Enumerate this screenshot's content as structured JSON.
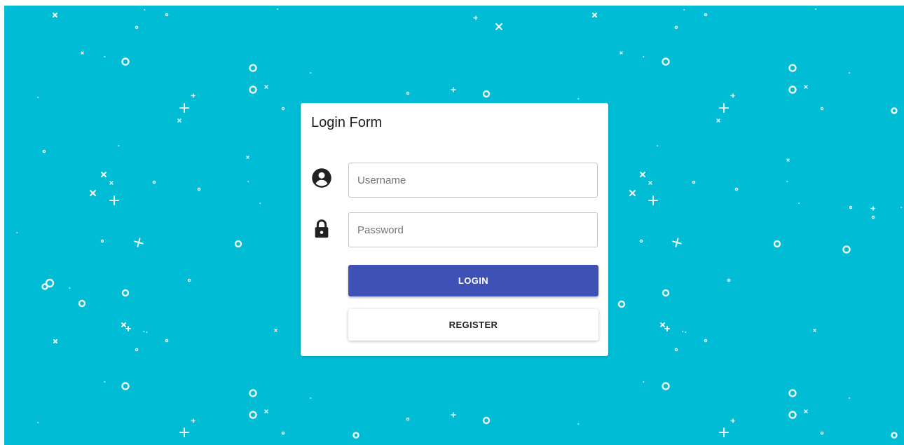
{
  "form": {
    "title": "Login Form",
    "username": {
      "placeholder": "Username",
      "value": "",
      "icon": "account-circle-icon"
    },
    "password": {
      "placeholder": "Password",
      "value": "",
      "icon": "lock-icon"
    },
    "login_label": "LOGIN",
    "register_label": "REGISTER"
  },
  "colors": {
    "background": "#00bcd4",
    "card": "#ffffff",
    "primary": "#3f51b5",
    "text": "#212121",
    "border": "#c4c4c4",
    "icon": "#212121"
  }
}
